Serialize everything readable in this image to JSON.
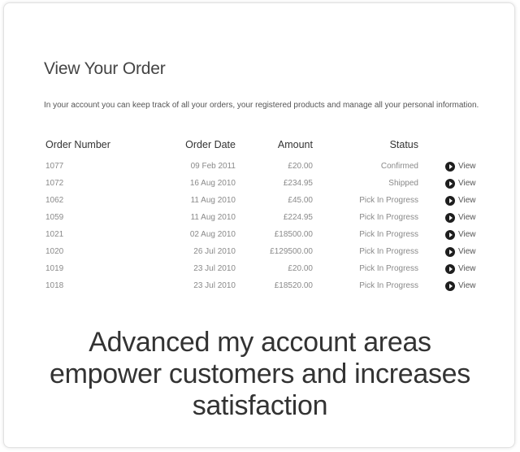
{
  "panel": {
    "title": "View Your Order",
    "intro": "In your account you can keep track of all your orders, your registered products and manage all your personal information."
  },
  "table": {
    "headers": {
      "order_number": "Order Number",
      "order_date": "Order Date",
      "amount": "Amount",
      "status": "Status"
    },
    "rows": [
      {
        "order_number": "1077",
        "order_date": "09 Feb 2011",
        "amount": "£20.00",
        "status": "Confirmed",
        "action": "View"
      },
      {
        "order_number": "1072",
        "order_date": "16 Aug 2010",
        "amount": "£234.95",
        "status": "Shipped",
        "action": "View"
      },
      {
        "order_number": "1062",
        "order_date": "11 Aug 2010",
        "amount": "£45.00",
        "status": "Pick In Progress",
        "action": "View"
      },
      {
        "order_number": "1059",
        "order_date": "11 Aug 2010",
        "amount": "£224.95",
        "status": "Pick In Progress",
        "action": "View"
      },
      {
        "order_number": "1021",
        "order_date": "02 Aug 2010",
        "amount": "£18500.00",
        "status": "Pick In Progress",
        "action": "View"
      },
      {
        "order_number": "1020",
        "order_date": "26 Jul 2010",
        "amount": "£129500.00",
        "status": "Pick In Progress",
        "action": "View"
      },
      {
        "order_number": "1019",
        "order_date": "23 Jul 2010",
        "amount": "£20.00",
        "status": "Pick In Progress",
        "action": "View"
      },
      {
        "order_number": "1018",
        "order_date": "23 Jul 2010",
        "amount": "£18520.00",
        "status": "Pick In Progress",
        "action": "View"
      }
    ]
  },
  "caption": {
    "line1": "Advanced my account areas",
    "line2": "empower customers and increases",
    "line3": "satisfaction"
  },
  "icons": {
    "view": "play-circle-icon"
  },
  "colors": {
    "title": "#444444",
    "muted_text": "#8a8a8a",
    "icon": "#1e1e1e"
  }
}
